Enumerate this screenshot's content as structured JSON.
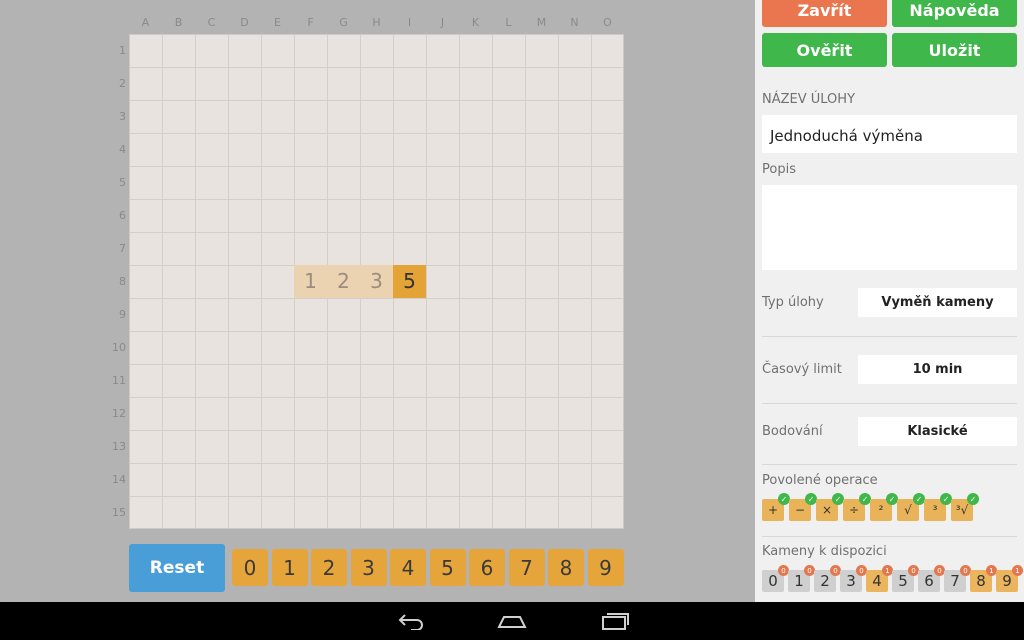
{
  "board": {
    "columns": [
      "A",
      "B",
      "C",
      "D",
      "E",
      "F",
      "G",
      "H",
      "I",
      "J",
      "K",
      "L",
      "M",
      "N",
      "O"
    ],
    "rows": [
      "1",
      "2",
      "3",
      "4",
      "5",
      "6",
      "7",
      "8",
      "9",
      "10",
      "11",
      "12",
      "13",
      "14",
      "15"
    ],
    "tiles": [
      {
        "value": "1",
        "col": "F",
        "row": "8",
        "state": "faded"
      },
      {
        "value": "2",
        "col": "G",
        "row": "8",
        "state": "faded"
      },
      {
        "value": "3",
        "col": "H",
        "row": "8",
        "state": "faded"
      },
      {
        "value": "5",
        "col": "I",
        "row": "8",
        "state": "active"
      }
    ]
  },
  "controls": {
    "reset_label": "Reset",
    "digits": [
      "0",
      "1",
      "2",
      "3",
      "4",
      "5",
      "6",
      "7",
      "8",
      "9"
    ]
  },
  "panel": {
    "close_label": "Zavřít",
    "help_label": "Nápověda",
    "verify_label": "Ověřit",
    "save_label": "Uložit",
    "task_name_label": "NÁZEV ÚLOHY",
    "task_name_value": "Jednoduchá výměna",
    "description_label": "Popis",
    "description_value": "",
    "task_type_label": "Typ úlohy",
    "task_type_value": "Vyměň kameny",
    "time_limit_label": "Časový limit",
    "time_limit_value": "10 min",
    "scoring_label": "Bodování",
    "scoring_value": "Klasické",
    "allowed_ops_label": "Povolené operace",
    "ops": [
      "+",
      "−",
      "×",
      "÷",
      "²",
      "√",
      "³",
      "³√"
    ],
    "stones_label": "Kameny k dispozici",
    "stones": [
      {
        "digit": "0",
        "count": "0",
        "state": "grey"
      },
      {
        "digit": "1",
        "count": "0",
        "state": "grey"
      },
      {
        "digit": "2",
        "count": "0",
        "state": "grey"
      },
      {
        "digit": "3",
        "count": "0",
        "state": "grey"
      },
      {
        "digit": "4",
        "count": "1",
        "state": "orange"
      },
      {
        "digit": "5",
        "count": "0",
        "state": "grey"
      },
      {
        "digit": "6",
        "count": "0",
        "state": "grey"
      },
      {
        "digit": "7",
        "count": "0",
        "state": "grey"
      },
      {
        "digit": "8",
        "count": "1",
        "state": "orange"
      },
      {
        "digit": "9",
        "count": "1",
        "state": "orange"
      }
    ]
  },
  "colors": {
    "orange_button": "#e9764e",
    "green_button": "#3fb74a",
    "blue_button": "#4a9ed8",
    "tile_orange": "#e6a53b"
  },
  "navbar": {
    "icons": [
      "back-icon",
      "home-icon",
      "recent-apps-icon"
    ]
  }
}
